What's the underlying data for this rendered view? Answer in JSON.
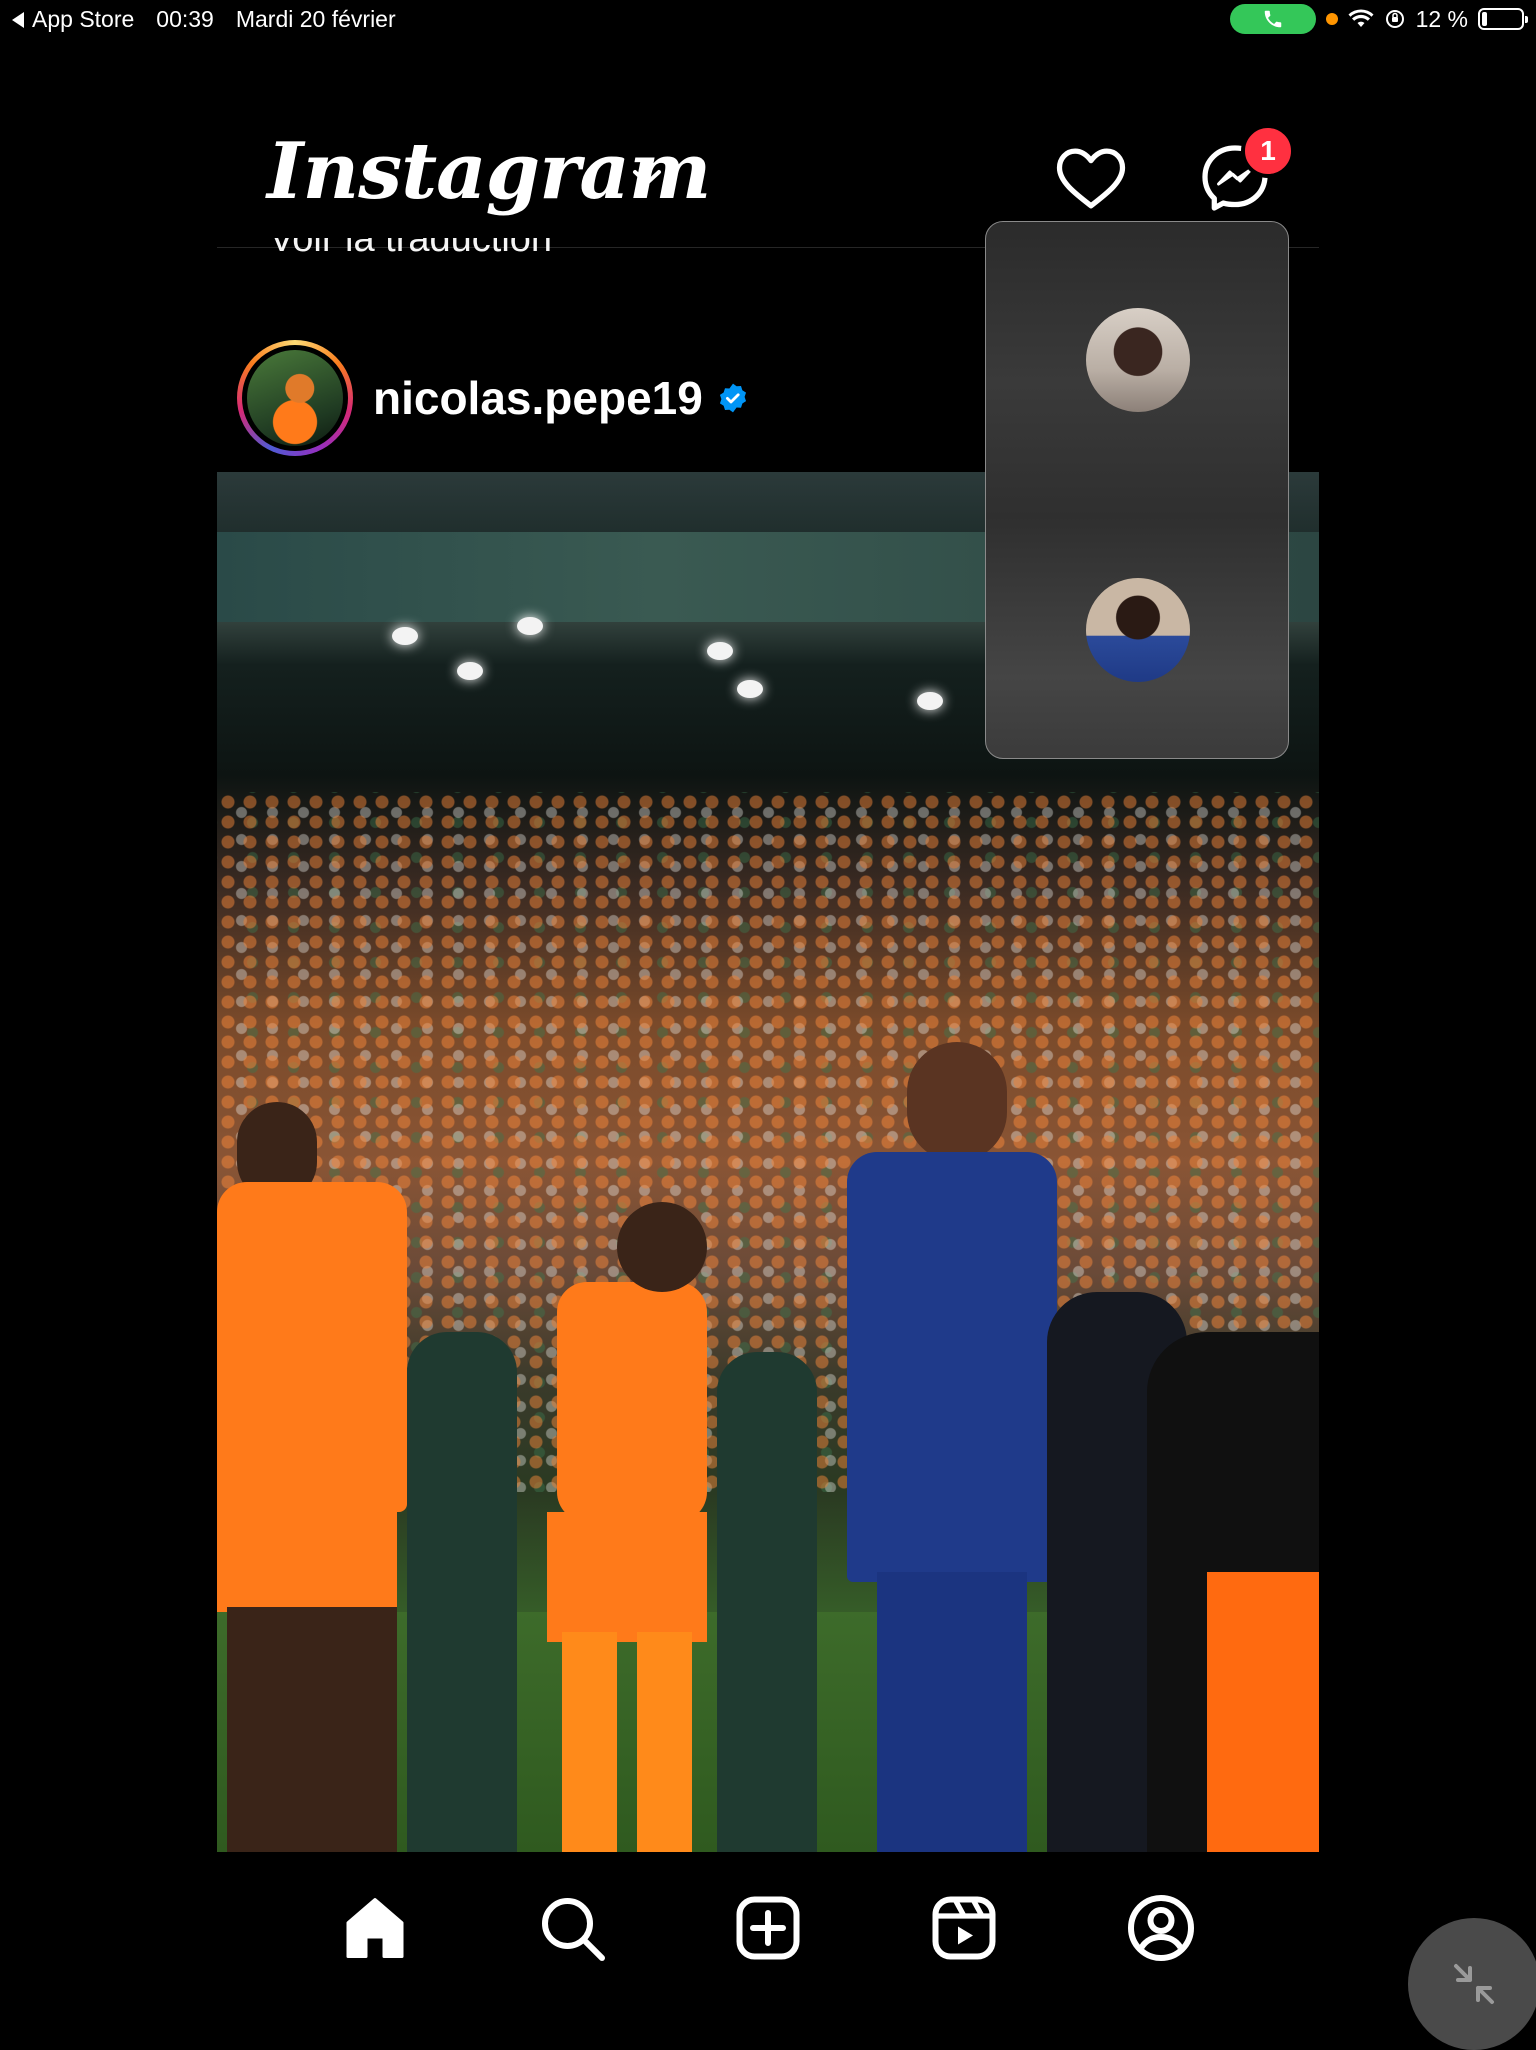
{
  "status_bar": {
    "back_app": "App Store",
    "time": "00:39",
    "date": "Mardi 20 février",
    "battery_percent": "12 %",
    "call_active_color": "#34c759",
    "icons": [
      "phone-icon",
      "wifi-icon",
      "orientation-lock-icon",
      "battery-icon"
    ]
  },
  "header": {
    "logo": "Instagram",
    "notification_badge": "1",
    "partial_text": "Voir la traduction",
    "icons": [
      "chevron-down-icon",
      "heart-icon",
      "messenger-icon"
    ]
  },
  "post": {
    "username": "nicolas.pepe19",
    "verified": true
  },
  "video_call": {
    "participants": [
      "participant-1",
      "participant-2"
    ]
  },
  "bottom_nav": {
    "items": [
      "home-icon",
      "search-icon",
      "create-icon",
      "reels-icon",
      "profile-icon"
    ]
  },
  "colors": {
    "background": "#000000",
    "badge": "#ff3040",
    "verified": "#0095f6"
  }
}
